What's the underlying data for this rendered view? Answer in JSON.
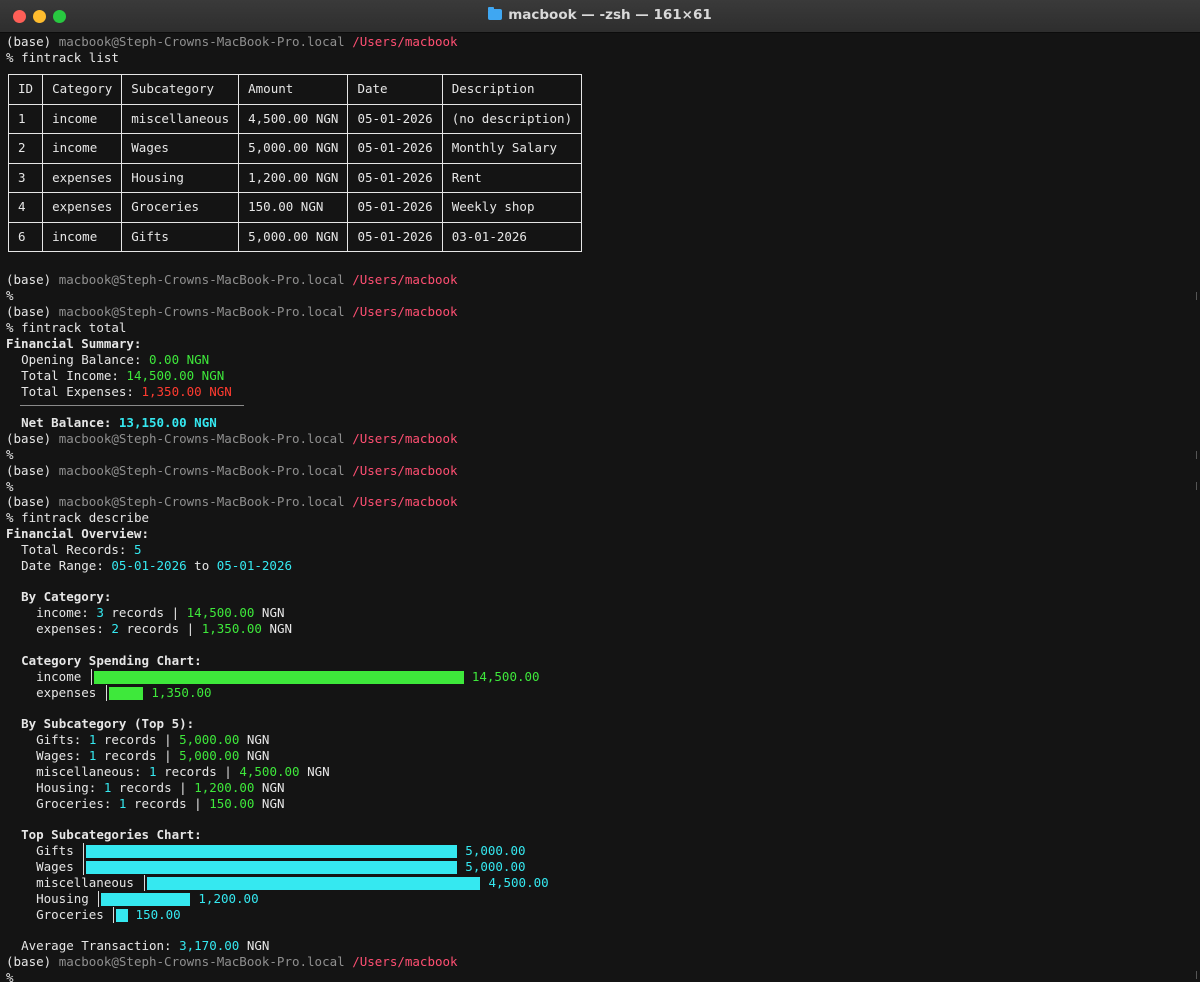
{
  "window": {
    "title": "macbook — -zsh — 161×61"
  },
  "prompt": {
    "env": "(base)",
    "host": "macbook@Steph-Crowns-MacBook-Pro.local",
    "path": "/Users/macbook",
    "symbol": "%"
  },
  "commands": {
    "list": "fintrack list",
    "total": "fintrack total",
    "describe": "fintrack describe"
  },
  "table": {
    "headers": [
      "ID",
      "Category",
      "Subcategory",
      "Amount",
      "Date",
      "Description"
    ],
    "rows": [
      [
        "1",
        "income",
        "miscellaneous",
        "4,500.00 NGN",
        "05-01-2026",
        "(no description)"
      ],
      [
        "2",
        "income",
        "Wages",
        "5,000.00 NGN",
        "05-01-2026",
        "Monthly Salary"
      ],
      [
        "3",
        "expenses",
        "Housing",
        "1,200.00 NGN",
        "05-01-2026",
        "Rent"
      ],
      [
        "4",
        "expenses",
        "Groceries",
        "150.00 NGN",
        "05-01-2026",
        "Weekly shop"
      ],
      [
        "6",
        "income",
        "Gifts",
        "5,000.00 NGN",
        "05-01-2026",
        "03-01-2026"
      ]
    ]
  },
  "summary": {
    "heading": "Financial Summary:",
    "opening_label": "Opening Balance: ",
    "opening_value": "0.00 NGN",
    "income_label": "Total Income: ",
    "income_value": "14,500.00 NGN",
    "expenses_label": "Total Expenses: ",
    "expenses_value": "1,350.00 NGN",
    "divider": "────────────────────────────",
    "net_label": "Net Balance: ",
    "net_value": "13,150.00 NGN"
  },
  "overview": {
    "heading": "Financial Overview:",
    "total_records_label": "Total Records: ",
    "total_records": "5",
    "date_range_label": "Date Range: ",
    "date_from": "05-01-2026",
    "to": " to ",
    "date_to": "05-01-2026",
    "by_category_heading": "By Category:",
    "by_category": [
      {
        "name": "income",
        "count": "3",
        "records": " records | ",
        "amount": "14,500.00",
        "currency": " NGN"
      },
      {
        "name": "expenses",
        "count": "2",
        "records": " records | ",
        "amount": "1,350.00",
        "currency": " NGN"
      }
    ],
    "category_chart_heading": "Category Spending Chart:",
    "by_subcategory_heading": "By Subcategory (Top 5):",
    "by_subcategory": [
      {
        "name": "Gifts",
        "count": "1",
        "records": " records | ",
        "amount": "5,000.00",
        "currency": " NGN"
      },
      {
        "name": "Wages",
        "count": "1",
        "records": " records | ",
        "amount": "5,000.00",
        "currency": " NGN"
      },
      {
        "name": "miscellaneous",
        "count": "1",
        "records": " records | ",
        "amount": "4,500.00",
        "currency": " NGN"
      },
      {
        "name": "Housing",
        "count": "1",
        "records": " records | ",
        "amount": "1,200.00",
        "currency": " NGN"
      },
      {
        "name": "Groceries",
        "count": "1",
        "records": " records | ",
        "amount": "150.00",
        "currency": " NGN"
      }
    ],
    "subcategory_chart_heading": "Top Subcategories Chart:",
    "avg_label": "Average Transaction: ",
    "avg_value": "3,170.00",
    "avg_currency": " NGN"
  },
  "chart_data": [
    {
      "type": "bar",
      "orientation": "horizontal",
      "title": "Category Spending Chart:",
      "categories": [
        "income",
        "expenses"
      ],
      "values": [
        14500,
        1350
      ],
      "value_labels": [
        "14,500.00",
        "1,350.00"
      ],
      "color": "#3ee83b"
    },
    {
      "type": "bar",
      "orientation": "horizontal",
      "title": "Top Subcategories Chart:",
      "categories": [
        "Gifts",
        "Wages",
        "miscellaneous",
        "Housing",
        "Groceries"
      ],
      "values": [
        5000,
        5000,
        4500,
        1200,
        150
      ],
      "value_labels": [
        "5,000.00",
        "5,000.00",
        "4,500.00",
        "1,200.00",
        "150.00"
      ],
      "color": "#35e8f0"
    }
  ],
  "colors": {
    "income": "#3ee83b",
    "expense": "#ff3b30",
    "accent": "#35e8f0",
    "path": "#ff4f72"
  }
}
